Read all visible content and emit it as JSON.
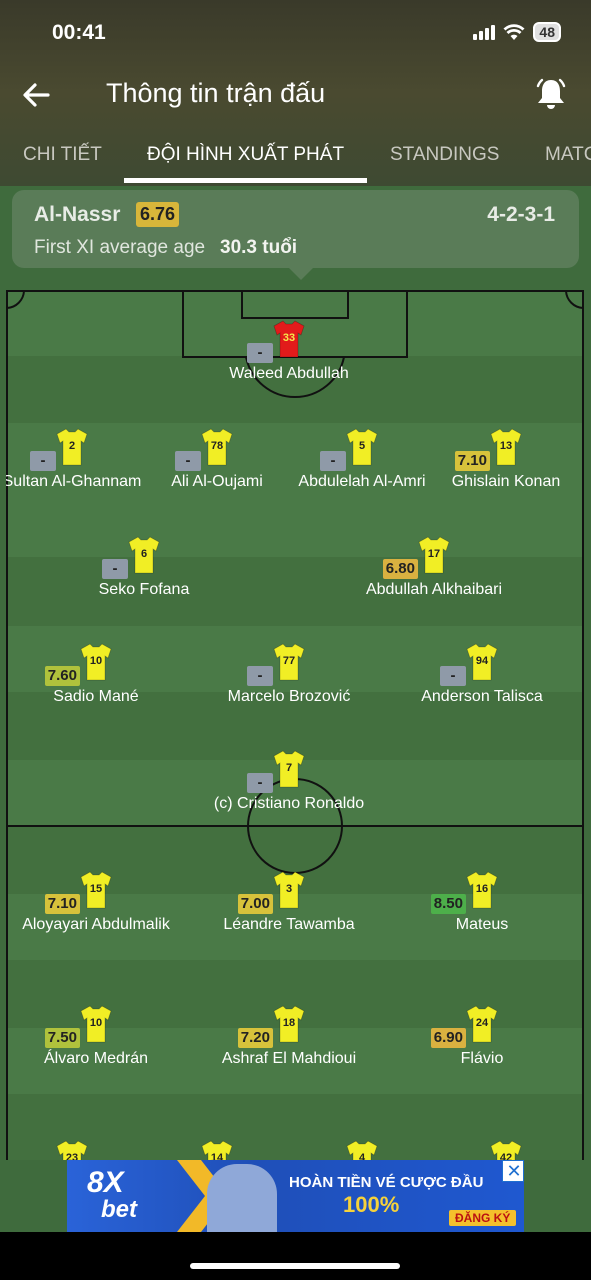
{
  "status_bar": {
    "time": "00:41",
    "battery": "48"
  },
  "header": {
    "title": "Thông tin trận đấu"
  },
  "tabs": [
    "CHI TIẾT",
    "ĐỘI HÌNH XUẤT PHÁT",
    "STANDINGS",
    "MATC"
  ],
  "active_tab": "ĐỘI HÌNH XUẤT PHÁT",
  "team": {
    "name": "Al-Nassr",
    "rating": "6.76",
    "formation": "4-2-3-1",
    "avg_age_label": "First XI average age",
    "avg_age_value": "30.3 tuổi"
  },
  "colors": {
    "shirt": "#f1ee25",
    "goalkeeper_shirt": "#e21b1b",
    "pitch_light": "#4a7a47",
    "pitch_dark": "#43703f"
  },
  "players": [
    {
      "name": "Waleed Abdullah",
      "number": "33",
      "rating": "-",
      "goalkeeper": true
    },
    {
      "name": "Sultan Al-Ghannam",
      "number": "2",
      "rating": "-"
    },
    {
      "name": "Ali Al-Oujami",
      "number": "78",
      "rating": "-"
    },
    {
      "name": "Abdulelah Al-Amri",
      "number": "5",
      "rating": "-"
    },
    {
      "name": "Ghislain Konan",
      "number": "13",
      "rating": "7.10"
    },
    {
      "name": "Seko Fofana",
      "number": "6",
      "rating": "-"
    },
    {
      "name": "Abdullah Alkhaibari",
      "number": "17",
      "rating": "6.80"
    },
    {
      "name": "Sadio Mané",
      "number": "10",
      "rating": "7.60"
    },
    {
      "name": "Marcelo Brozović",
      "number": "77",
      "rating": "-"
    },
    {
      "name": "Anderson Talisca",
      "number": "94",
      "rating": "-"
    },
    {
      "name": "(c) Cristiano Ronaldo",
      "number": "7",
      "rating": "-"
    },
    {
      "name": "Aloyayari Abdulmalik",
      "number": "15",
      "rating": "7.10"
    },
    {
      "name": "Léandre Tawamba",
      "number": "3",
      "rating": "7.00"
    },
    {
      "name": "Mateus",
      "number": "16",
      "rating": "8.50"
    },
    {
      "name": "Álvaro Medrán",
      "number": "10",
      "rating": "7.50"
    },
    {
      "name": "Ashraf El Mahdioui",
      "number": "18",
      "rating": "7.20"
    },
    {
      "name": "Flávio",
      "number": "24",
      "rating": "6.90"
    },
    {
      "name": "",
      "number": "23",
      "rating": ""
    },
    {
      "name": "",
      "number": "14",
      "rating": ""
    },
    {
      "name": "",
      "number": "4",
      "rating": ""
    },
    {
      "name": "",
      "number": "42",
      "rating": ""
    }
  ],
  "ad": {
    "logo_top": "8X",
    "logo_bottom": "bet",
    "line1": "HOÀN TIỀN VÉ CƯỢC ĐẦU",
    "line2": "100%",
    "cta": "ĐĂNG KÝ",
    "close": "✕"
  }
}
